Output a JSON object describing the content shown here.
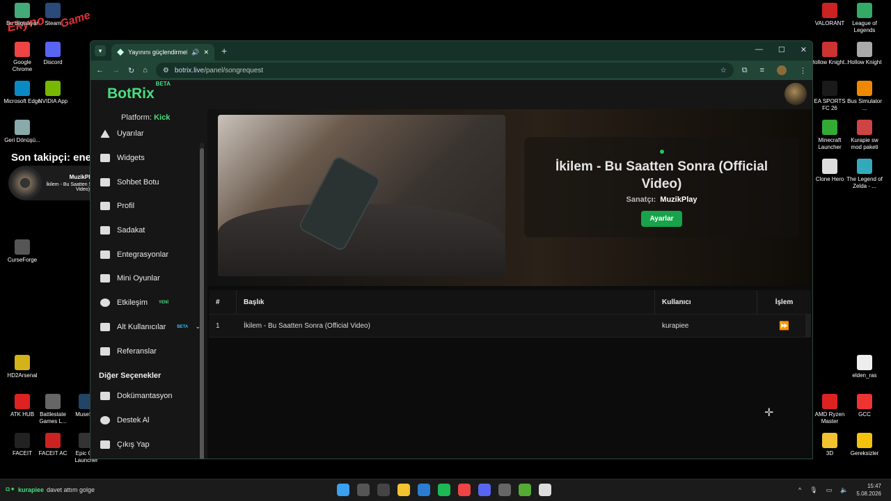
{
  "desktop": {
    "left_icons": [
      {
        "label": "Bu bilgisayar",
        "color": "#4a7"
      },
      {
        "label": "Steam",
        "color": "#2a4a7a"
      },
      {
        "label": "Google Chrome",
        "color": "#e44"
      },
      {
        "label": "Discord",
        "color": "#5865f2"
      },
      {
        "label": "Microsoft Edge",
        "color": "#0a8ac4"
      },
      {
        "label": "NVIDIA App",
        "color": "#76b900"
      },
      {
        "label": "Geri Dönüşü...",
        "color": "#8aa"
      },
      {
        "label": "CurseForge",
        "color": "#555"
      },
      {
        "label": "HD2Arsenal",
        "color": "#d4b21a"
      },
      {
        "label": "ATK HUB",
        "color": "#d22"
      },
      {
        "label": "Battlestate Games L...",
        "color": "#666"
      },
      {
        "label": "MuseS...",
        "color": "#246"
      },
      {
        "label": "FACEIT",
        "color": "#222"
      },
      {
        "label": "FACEIT AC",
        "color": "#c22"
      },
      {
        "label": "Epic G... Launcher",
        "color": "#333"
      }
    ],
    "right_icons": [
      {
        "label": "VALORANT",
        "color": "#c22"
      },
      {
        "label": "League of Legends",
        "color": "#3a6"
      },
      {
        "label": "Hollow Knight...",
        "color": "#c33"
      },
      {
        "label": "Hollow Knight",
        "color": "#aaa"
      },
      {
        "label": "EA SPORTS FC 26",
        "color": "#1a1a1a"
      },
      {
        "label": "Bus Simulator ...",
        "color": "#e80"
      },
      {
        "label": "Minecraft Launcher",
        "color": "#3a3"
      },
      {
        "label": "Kurapie sw mod paketi",
        "color": "#c44"
      },
      {
        "label": "Clone Hero",
        "color": "#ddd"
      },
      {
        "label": "The Legend of Zelda - ...",
        "color": "#3ab"
      },
      {
        "label": "elden_ras",
        "color": "#eee"
      },
      {
        "label": "AMD Ryzen Master",
        "color": "#d22"
      },
      {
        "label": "GCC",
        "color": "#e33"
      },
      {
        "label": "3D",
        "color": "#f2c230"
      },
      {
        "label": "Gereksizler",
        "color": "#f4c20d"
      }
    ]
  },
  "overlay": {
    "follower": "Son takipçi: enesduger",
    "music_title": "MuzikPlay",
    "music_song": "İkilem - Bu Saatten Sonra (Official Video)"
  },
  "browser": {
    "tab_title": "Yayınını güçlendirmek için e",
    "url_host": "botrix.live",
    "url_path": "/panel/songrequest"
  },
  "app": {
    "brand": "BotRix",
    "brand_badge": "BETA",
    "platform_label": "Platform:",
    "platform_value": "Kick",
    "nav": [
      {
        "label": "Uyarılar",
        "icon": "warning-icon"
      },
      {
        "label": "Widgets",
        "icon": "widgets-icon"
      },
      {
        "label": "Sohbet Botu",
        "icon": "chat-bot-icon"
      },
      {
        "label": "Profil",
        "icon": "profile-card-icon"
      },
      {
        "label": "Sadakat",
        "icon": "trophy-icon"
      },
      {
        "label": "Entegrasyonlar",
        "icon": "integrations-icon"
      },
      {
        "label": "Mini Oyunlar",
        "icon": "gamepad-icon"
      },
      {
        "label": "Etkileşim",
        "icon": "music-note-icon",
        "badge": "YENİ"
      },
      {
        "label": "Alt Kullanıcılar",
        "icon": "users-icon",
        "badge": "BETA"
      },
      {
        "label": "Referanslar",
        "icon": "referrals-icon"
      }
    ],
    "section_other": "Diğer Seçenekler",
    "other_nav": [
      {
        "label": "Dokümantasyon",
        "icon": "docs-icon"
      },
      {
        "label": "Destek Al",
        "icon": "help-icon"
      },
      {
        "label": "Çıkış Yap",
        "icon": "logout-icon"
      }
    ]
  },
  "now_playing": {
    "title": "İkilem - Bu Saatten Sonra (Official Video)",
    "artist_label": "Sanatçı:",
    "artist": "MuzikPlay",
    "settings_button": "Ayarlar"
  },
  "queue": {
    "headers": {
      "num": "#",
      "title": "Başlık",
      "user": "Kullanıcı",
      "action": "İşlem"
    },
    "rows": [
      {
        "num": "1",
        "title": "İkilem - Bu Saatten Sonra (Official Video)",
        "user": "kurapiee"
      }
    ]
  },
  "taskbar": {
    "notif_user": "kurapiee",
    "notif_text": "davet attım golge",
    "time": "15:47",
    "date": "5.08.2026",
    "apps": [
      {
        "name": "start-icon",
        "color": "#3aa0f0"
      },
      {
        "name": "search-icon",
        "color": "#555"
      },
      {
        "name": "store-icon",
        "color": "#444"
      },
      {
        "name": "file-explorer-icon",
        "color": "#f2c230"
      },
      {
        "name": "mail-icon",
        "color": "#2b7cd3"
      },
      {
        "name": "spotify-icon",
        "color": "#1db954"
      },
      {
        "name": "chrome-icon",
        "color": "#e44"
      },
      {
        "name": "discord-icon",
        "color": "#5865f2"
      },
      {
        "name": "steam-icon",
        "color": "#666"
      },
      {
        "name": "minecraft-icon",
        "color": "#5a3"
      },
      {
        "name": "obs-icon",
        "color": "#ddd"
      }
    ]
  }
}
